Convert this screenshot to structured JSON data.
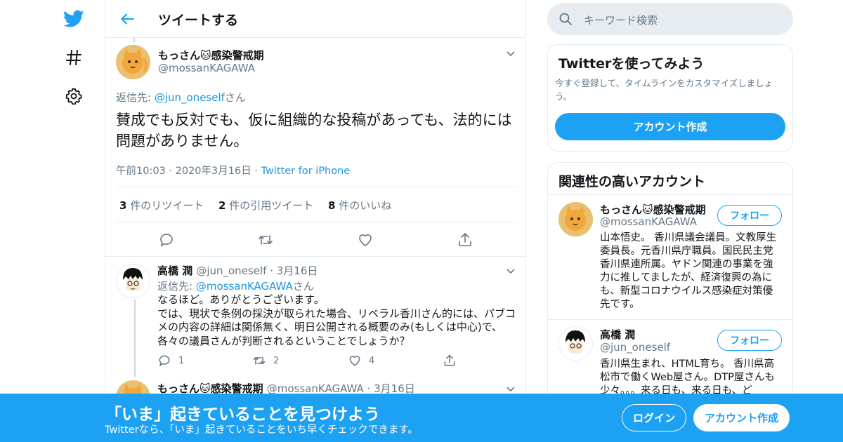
{
  "colors": {
    "brand": "#1da1f2",
    "link": "#1b95e0",
    "muted": "#657786",
    "border": "#e6ecf0"
  },
  "nav": {
    "icons": [
      "twitter-bird-icon",
      "hashtag-icon",
      "gear-icon"
    ]
  },
  "header": {
    "title": "ツイートする"
  },
  "main_tweet": {
    "name": "もっさん",
    "emoji": "🐱",
    "name_suffix": "感染警戒期",
    "handle": "@mossanKAGAWA",
    "reply_prefix": "返信先: ",
    "reply_to": "@jun_oneself",
    "reply_suffix": "さん",
    "text": "賛成でも反対でも、仮に組織的な投稿があっても、法的には問題がありません。",
    "time": "午前10:03",
    "date": "2020年3月16日",
    "source": "Twitter for iPhone",
    "stats": [
      {
        "count": "3",
        "label": "件のリツイート"
      },
      {
        "count": "2",
        "label": "件の引用ツイート"
      },
      {
        "count": "8",
        "label": "件のいいね"
      }
    ]
  },
  "reply_tweet": {
    "name": "高橋 潤",
    "handle": "@jun_oneself",
    "date": "3月16日",
    "reply_prefix": "返信先: ",
    "reply_to": "@mossanKAGAWA",
    "reply_suffix": "さん",
    "text_lines": [
      "なるほど。ありがとうございます。",
      "では、現状で条例の採決が取られた場合、リベラル香川さん的には、パブコメの内容の詳細は関係無く、明日公開される概要のみ(もしくは中心)で、各々の議員さんが判断されるということでしょうか？"
    ],
    "reply_count": "1",
    "retweet_count": "2",
    "like_count": "4"
  },
  "third_tweet": {
    "name": "もっさん",
    "emoji": "🐱",
    "name_suffix": "感染警戒期",
    "handle": "@mossanKAGAWA",
    "date": "3月16日"
  },
  "search": {
    "placeholder": "キーワード検索"
  },
  "signup_card": {
    "title": "Twitterを使ってみよう",
    "desc": "今すぐ登録して、タイムラインをカスタマイズしましょう。",
    "button": "アカウント作成"
  },
  "related": {
    "title": "関連性の高いアカウント",
    "follow_label": "フォロー",
    "accounts": [
      {
        "name": "もっさん",
        "emoji": "🐱",
        "name_suffix": "感染警戒期",
        "handle": "@mossanKAGAWA",
        "bio": "山本悟史。 香川県議会議員。文教厚生委員長。元香川県庁職員。国民民主党香川県連所属。ヤドン関連の事業を強力に推してましたが、経済復興の為にも、新型コロナウイルス感染症対策優先です。"
      },
      {
        "name": "高橋 潤",
        "handle": "@jun_oneself",
        "bio": "香川県生まれ、HTML育ち。 香川県高松市で働くWeb屋さん。DTP屋さんも少々。。。来る日も、来る日も、ど"
      }
    ]
  },
  "banner": {
    "title": "「いま」起きていることを見つけよう",
    "subtitle": "Twitterなら、「いま」起きていることをいち早くチェックできます。",
    "login": "ログイン",
    "signup": "アカウント作成"
  }
}
